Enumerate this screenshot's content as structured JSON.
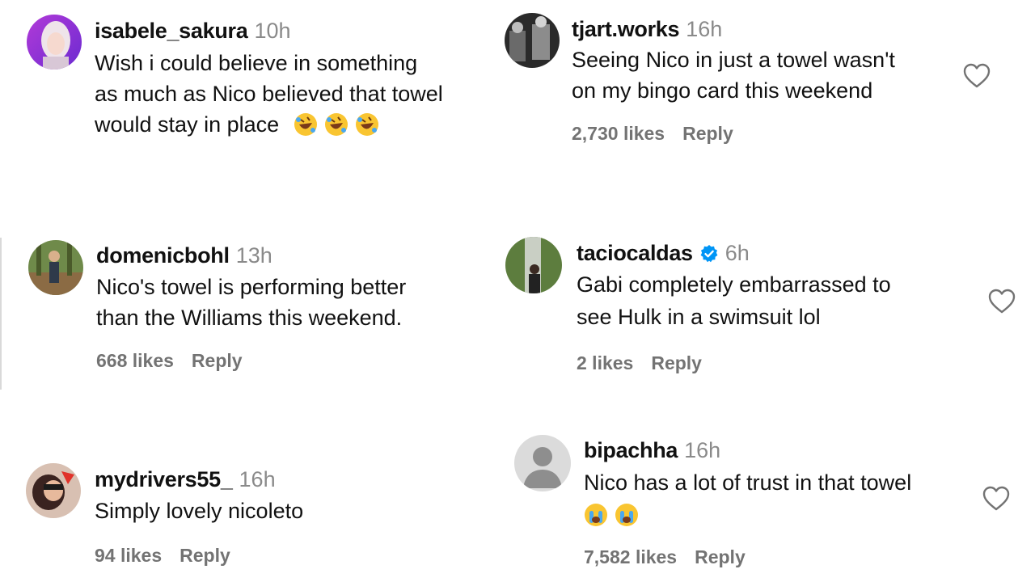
{
  "comments": [
    {
      "username": "isabele_sakura",
      "time": "10h",
      "lines": [
        "Wish i could believe in something",
        "as much as Nico believed that towel",
        "would stay in place"
      ],
      "emojis": [
        "rofl-emoji",
        "rofl-emoji",
        "rofl-emoji"
      ]
    },
    {
      "username": "tjart.works",
      "time": "16h",
      "lines": [
        "Seeing Nico in just a towel wasn't",
        "on my bingo card this weekend"
      ],
      "likes": "2,730 likes",
      "reply": "Reply"
    },
    {
      "username": "domenicbohl",
      "time": "13h",
      "lines": [
        "Nico's towel is performing better",
        "than the Williams this weekend."
      ],
      "likes": "668 likes",
      "reply": "Reply"
    },
    {
      "username": "taciocaldas",
      "time": "6h",
      "verified": true,
      "lines": [
        "Gabi completely embarrassed to",
        "see Hulk in a swimsuit lol"
      ],
      "likes": "2 likes",
      "reply": "Reply"
    },
    {
      "username": "mydrivers55_",
      "time": "16h",
      "lines": [
        "Simply lovely nicoleto"
      ],
      "likes": "94 likes",
      "reply": "Reply"
    },
    {
      "username": "bipachha",
      "time": "16h",
      "lines": [
        "Nico has a lot of trust in that towel"
      ],
      "emojis": [
        "crying-emoji",
        "crying-emoji"
      ],
      "likes": "7,582 likes",
      "reply": "Reply"
    }
  ],
  "colors": {
    "username": "#111111",
    "timestamp": "#8a8a8a",
    "meta": "#737373",
    "verified": "#0095f6"
  }
}
